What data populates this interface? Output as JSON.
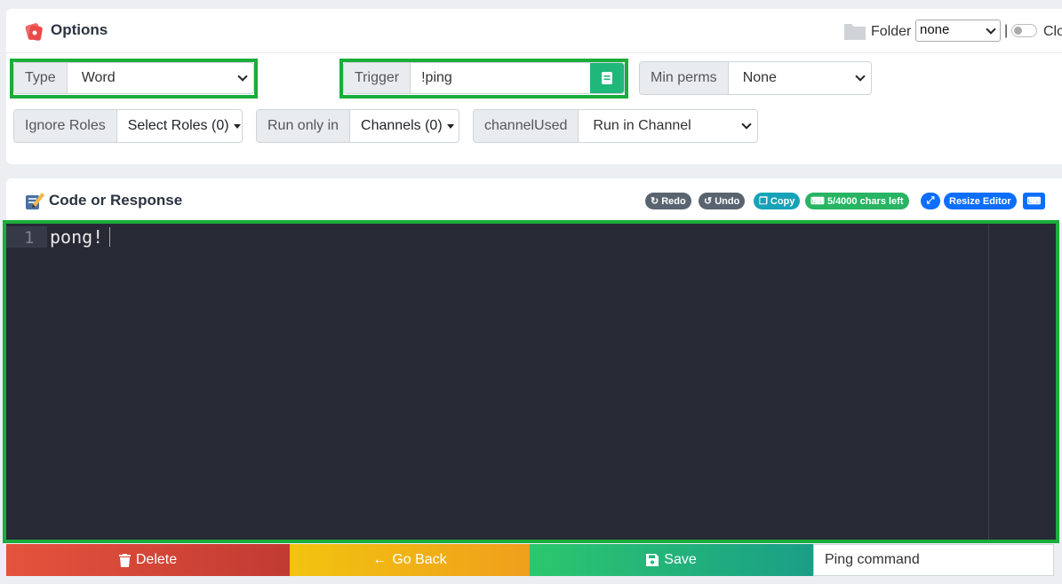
{
  "options": {
    "title": "Options",
    "folder_label": "Folder",
    "folder_value": "none",
    "separator": "|",
    "toggle_label": "Close"
  },
  "type": {
    "label": "Type",
    "value": "Word"
  },
  "trigger": {
    "label": "Trigger",
    "value": "!ping"
  },
  "min_perms": {
    "label": "Min perms",
    "value": "None"
  },
  "ignore_roles": {
    "label": "Ignore Roles",
    "button": "Select Roles (0)"
  },
  "run_only_in": {
    "label": "Run only in",
    "button": "Channels (0)"
  },
  "channel_used": {
    "label": "channelUsed",
    "value": "Run in Channel"
  },
  "code": {
    "title": "Code or Response",
    "toolbar": {
      "redo": "Redo",
      "undo": "Undo",
      "copy": "Copy",
      "chars_left": "5/4000 chars left",
      "resize": "Resize Editor"
    },
    "line_number": "1",
    "content": "pong!"
  },
  "footer": {
    "delete": "Delete",
    "go_back": "Go Back",
    "save": "Save",
    "description": "Ping command"
  },
  "colors": {
    "highlight": "#1aad3b",
    "editor_bg": "#272a35",
    "delete": "#d9443a",
    "go_back": "#f0b214",
    "save": "#22b87a",
    "pill_gray": "#5a6470",
    "pill_teal": "#17a2b8",
    "pill_green": "#28b463",
    "pill_blue": "#0d6efd"
  }
}
